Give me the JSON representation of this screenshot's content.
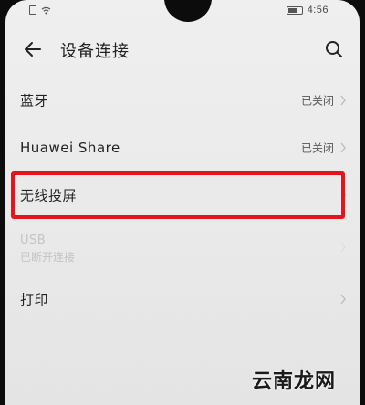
{
  "status_bar": {
    "time": "4:56",
    "icons": [
      "sim-icon",
      "wifi-icon",
      "battery-icon"
    ]
  },
  "header": {
    "back_icon": "arrow-left-icon",
    "title": "设备连接",
    "search_icon": "search-icon"
  },
  "settings": {
    "items": [
      {
        "label": "蓝牙",
        "status": "已关闭",
        "enabled": true
      },
      {
        "label": "Huawei Share",
        "status": "已关闭",
        "enabled": true
      },
      {
        "label": "无线投屏",
        "status": "",
        "enabled": true,
        "highlighted": true
      },
      {
        "label": "USB",
        "sublabel": "已断开连接",
        "enabled": false
      },
      {
        "label": "打印",
        "status": "",
        "enabled": true
      }
    ]
  },
  "colors": {
    "highlight": "#e8141b",
    "text_primary": "#222222",
    "text_secondary": "#555555",
    "text_disabled": "#c4c4c4"
  },
  "watermark": "云南龙网"
}
